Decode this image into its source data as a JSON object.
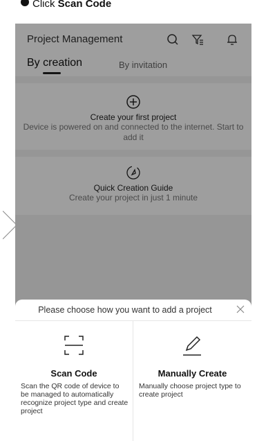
{
  "instruction": {
    "step_prefix": "Click ",
    "step_target": "Scan Code"
  },
  "header": {
    "title": "Project Management",
    "icons": [
      "search-icon",
      "filter-icon",
      "bell-icon"
    ]
  },
  "tabs": [
    {
      "label": "By creation",
      "active": true
    },
    {
      "label": "By invitation",
      "active": false
    }
  ],
  "cards": {
    "create": {
      "icon": "plus-circle-icon",
      "title": "Create your first project",
      "subtitle": "Device is powered on and connected to the internet. Start to add it"
    },
    "guide": {
      "icon": "rocket-icon",
      "title": "Quick Creation Guide",
      "subtitle": "Create your project in just 1 minute"
    }
  },
  "sheet": {
    "title": "Please choose how you want to add a project",
    "options": [
      {
        "icon": "scan-icon",
        "label": "Scan Code",
        "description": "Scan the QR code of device to be managed to automatically recognize project type and create project"
      },
      {
        "icon": "pencil-icon",
        "label": "Manually Create",
        "description": "Manually choose project type to create project"
      }
    ]
  },
  "colors": {
    "overlay": "#00000061",
    "background": "#f2f2f2",
    "text": "#222222"
  }
}
